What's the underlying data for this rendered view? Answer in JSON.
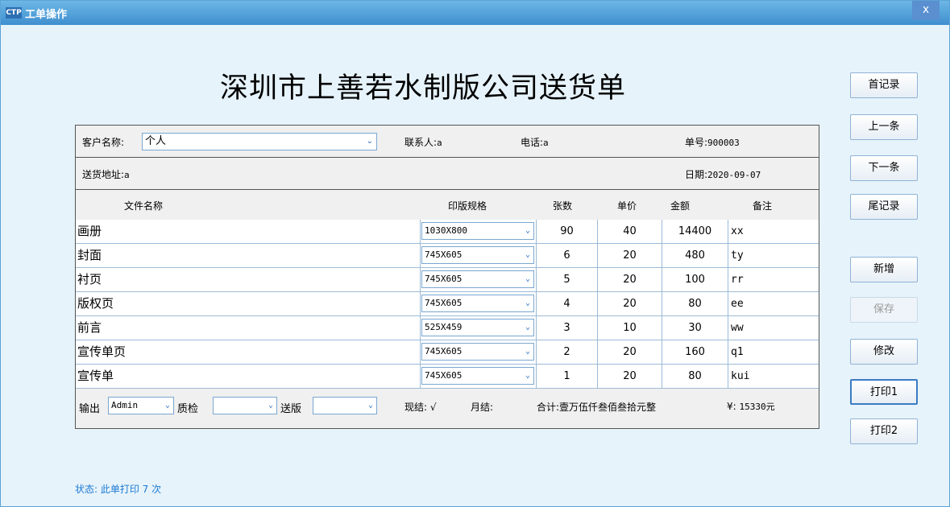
{
  "window": {
    "title": "工单操作",
    "app_icon": "CTP",
    "close_glyph": "x"
  },
  "doc_title": "深圳市上善若水制版公司送货单",
  "header": {
    "customer_label": "客户名称:",
    "customer_value": "个人",
    "contact_label": "联系人:",
    "contact_value": "a",
    "phone_label": "电话:",
    "phone_value": "a",
    "order_no_label": "单号:",
    "order_no_value": "900003",
    "address_label": "送货地址:",
    "address_value": "a",
    "date_label": "日期:",
    "date_value": "2020-09-07"
  },
  "columns": [
    "文件名称",
    "印版规格",
    "张数",
    "单价",
    "金额",
    "备注"
  ],
  "items": [
    {
      "name": "画册",
      "spec": "1030X800",
      "sheets": "90",
      "price": "40",
      "amount": "14400",
      "note": "xx"
    },
    {
      "name": "封面",
      "spec": "745X605",
      "sheets": "6",
      "price": "20",
      "amount": "480",
      "note": "ty"
    },
    {
      "name": "衬页",
      "spec": "745X605",
      "sheets": "5",
      "price": "20",
      "amount": "100",
      "note": "rr"
    },
    {
      "name": "版权页",
      "spec": "745X605",
      "sheets": "4",
      "price": "20",
      "amount": "80",
      "note": "ee"
    },
    {
      "name": "前言",
      "spec": "525X459",
      "sheets": "3",
      "price": "10",
      "amount": "30",
      "note": "ww"
    },
    {
      "name": "宣传单页",
      "spec": "745X605",
      "sheets": "2",
      "price": "20",
      "amount": "160",
      "note": "q1"
    },
    {
      "name": "宣传单",
      "spec": "745X605",
      "sheets": "1",
      "price": "20",
      "amount": "80",
      "note": "kui"
    }
  ],
  "footer": {
    "output_label": "输出",
    "output_value": "Admin",
    "qc_label": "质检",
    "qc_value": "",
    "send_label": "送版",
    "send_value": "",
    "cash_label": "现结:",
    "cash_mark": "√",
    "monthly_label": "月结:",
    "total_label": "合计:",
    "total_words": "壹万伍仟叁佰叁拾元整",
    "yen_label": "¥:",
    "total_amount": "15330元"
  },
  "buttons": {
    "first": "首记录",
    "prev": "上一条",
    "next": "下一条",
    "last": "尾记录",
    "add": "新增",
    "save": "保存",
    "edit": "修改",
    "print1": "打印1",
    "print2": "打印2"
  },
  "status": "状态: 此单打印 7 次"
}
